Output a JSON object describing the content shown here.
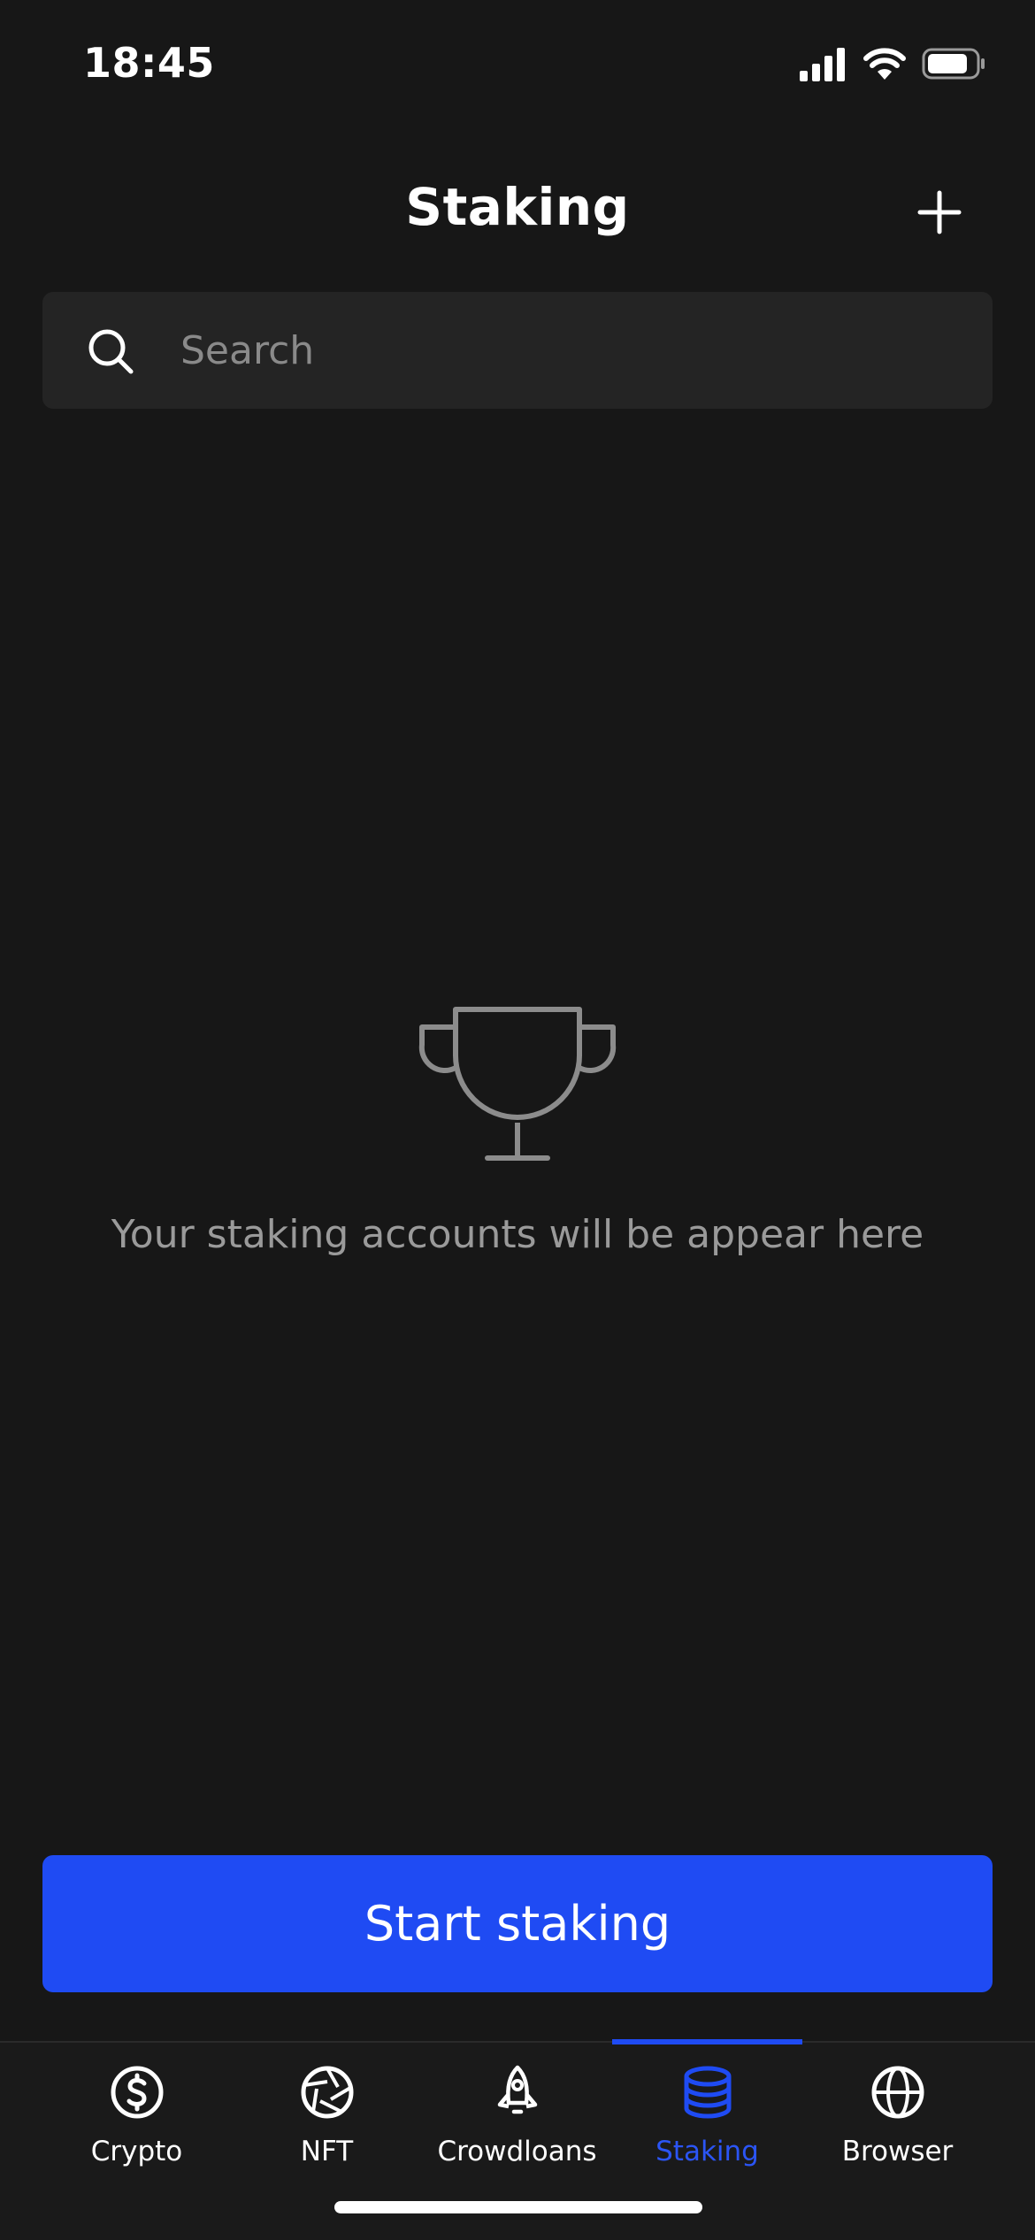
{
  "status_bar": {
    "time": "18:45"
  },
  "header": {
    "title": "Staking",
    "add_icon": "plus-icon"
  },
  "search": {
    "placeholder": "Search",
    "value": "",
    "icon": "search-icon"
  },
  "empty_state": {
    "icon": "trophy-icon",
    "message": "Your staking accounts will be appear here"
  },
  "cta": {
    "label": "Start staking"
  },
  "tab_bar": {
    "active": "Staking",
    "tabs": [
      {
        "label": "Crypto",
        "icon": "dollar-circle-icon"
      },
      {
        "label": "NFT",
        "icon": "aperture-icon"
      },
      {
        "label": "Crowdloans",
        "icon": "rocket-icon"
      },
      {
        "label": "Staking",
        "icon": "database-icon"
      },
      {
        "label": "Browser",
        "icon": "globe-icon"
      }
    ]
  },
  "colors": {
    "background": "#171717",
    "accent": "#1f4bf3",
    "muted_text": "#9a9a9a",
    "search_bg": "#242424"
  }
}
